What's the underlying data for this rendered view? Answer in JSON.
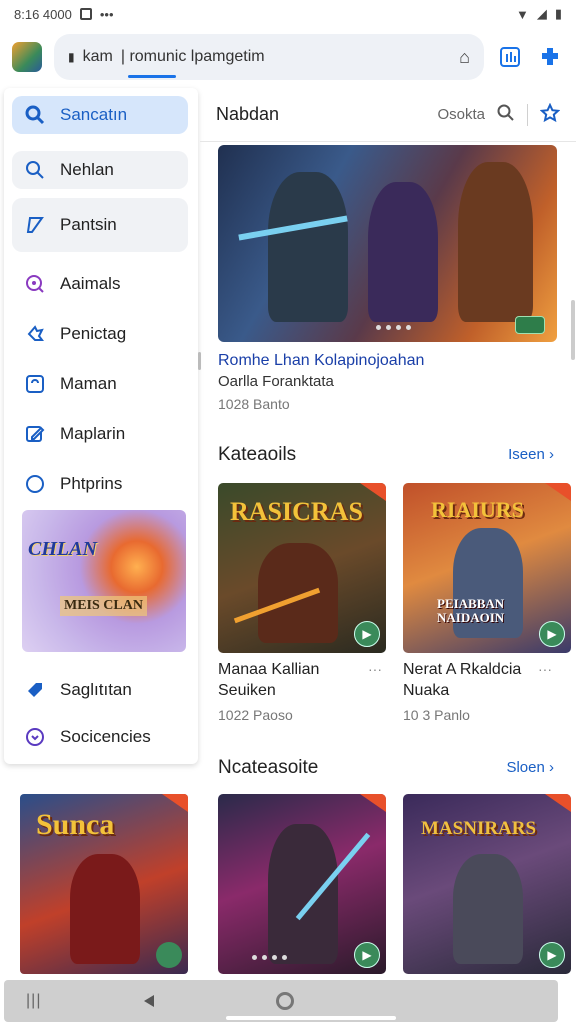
{
  "status_bar": {
    "time": "8:16 4000",
    "dots": "•••",
    "wifi_icon": "wifi-icon",
    "signal_icon": "signal-icon",
    "battery_icon": "battery-icon"
  },
  "url_bar": {
    "host": "kam",
    "path": "| romunic lpamgetim",
    "lock_icon": "lock-icon",
    "share_icon": "share-icon",
    "tabs_icon": "tabs-icon",
    "extension_icon": "extension-icon"
  },
  "sidebar": {
    "items": [
      {
        "label": "Sancatın",
        "icon": "search-icon",
        "state": "active"
      },
      {
        "label": "Nehlan",
        "icon": "search-outline-icon",
        "state": "soft"
      },
      {
        "label": "Pantsin",
        "icon": "edit-icon",
        "state": "soft"
      },
      {
        "label": "Aaimals",
        "icon": "zoom-icon",
        "state": "normal"
      },
      {
        "label": "Penictag",
        "icon": "puzzle-icon",
        "state": "normal"
      },
      {
        "label": "Maman",
        "icon": "frame-icon",
        "state": "normal"
      },
      {
        "label": "Maplarin",
        "icon": "pencil-icon",
        "state": "normal"
      },
      {
        "label": "Phtprins",
        "icon": "circle-icon",
        "state": "normal"
      },
      {
        "label": "Saglıtıtan",
        "icon": "tag-icon",
        "state": "normal"
      },
      {
        "label": "Socicencies",
        "icon": "chevron-circle-icon",
        "state": "normal"
      }
    ],
    "banner": {
      "title": "CHLAN",
      "subtitle": "MEIS CLAN"
    }
  },
  "main": {
    "header": {
      "title": "Nabdan",
      "search_label": "Osokta",
      "search_icon": "search-icon",
      "bookmark_icon": "star-icon"
    },
    "hero": {
      "title": "Romhe Lhan Kolapinojoahan",
      "subtitle": "Oarlla Foranktata",
      "meta": "1028 Banto",
      "badge_icon": "badge-icon"
    },
    "section1": {
      "title": "Kateaoils",
      "link": "Iseen",
      "cards": [
        {
          "art_title": "RASICRAS",
          "name": "Manaa Kallian Seuiken",
          "meta": "1022 Paoso",
          "more": "···"
        },
        {
          "art_title": "RIAIURS",
          "art_sub": "PEIABBAN NAIDAOIN",
          "name": "Nerat A Rkaldcia Nuaka",
          "meta": "10 3 Panlo",
          "more": "···"
        }
      ]
    },
    "section2": {
      "title": "Ncateasoite",
      "link": "Sloen",
      "cards": [
        {
          "art_title": "Sunca"
        },
        {
          "art_title": ""
        },
        {
          "art_title": "MASNIRARS"
        }
      ]
    }
  },
  "colors": {
    "accent": "#1a73e8",
    "active_bg": "#d6e6fb",
    "link": "#1a5fc4"
  }
}
